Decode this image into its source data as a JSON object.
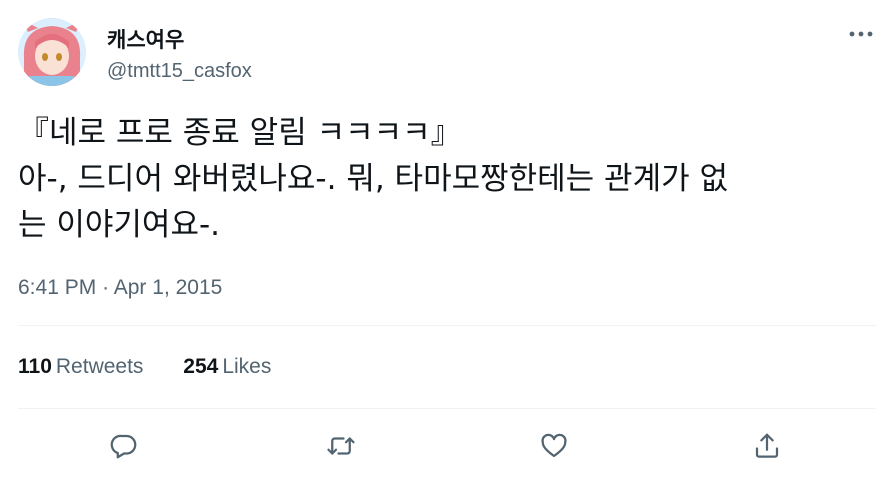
{
  "author": {
    "display_name": "캐스여우",
    "handle": "@tmtt15_casfox"
  },
  "tweet": {
    "lines": [
      "『네로 프로 종료 알림 ㅋㅋㅋㅋ』",
      "아-, 드디어 와버렸나요-. 뭐, 타마모짱한테는 관계가 없",
      "는 이야기여요-."
    ],
    "time": "6:41 PM",
    "separator": "·",
    "date": "Apr 1, 2015"
  },
  "stats": {
    "retweets_count": "110",
    "retweets_label": "Retweets",
    "likes_count": "254",
    "likes_label": "Likes"
  },
  "icons": {
    "more": "more-icon",
    "reply": "reply-icon",
    "retweet": "retweet-icon",
    "like": "like-icon",
    "share": "share-icon"
  },
  "colors": {
    "text_primary": "#0f1419",
    "text_secondary": "#536471",
    "divider": "#eff3f4"
  }
}
